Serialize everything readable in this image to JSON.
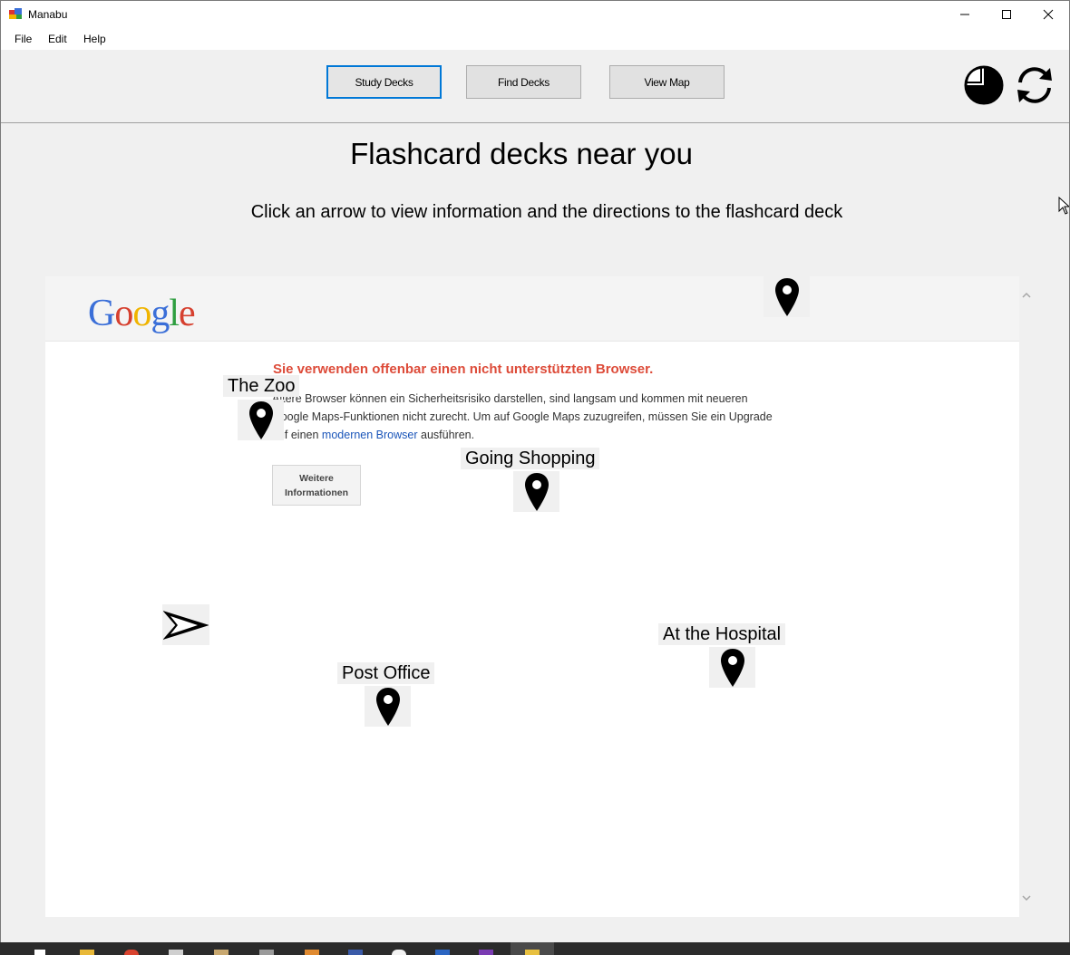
{
  "window": {
    "title": "Manabu",
    "controls": [
      "minimize",
      "maximize",
      "close"
    ]
  },
  "menu": {
    "items": [
      "File",
      "Edit",
      "Help"
    ]
  },
  "toolbar": {
    "buttons": [
      {
        "label": "Study Decks",
        "active": true
      },
      {
        "label": "Find Decks",
        "active": false
      },
      {
        "label": "View Map",
        "active": false
      }
    ],
    "icons": [
      "pie-chart-icon",
      "refresh-icon"
    ]
  },
  "page": {
    "heading": "Flashcard decks near you",
    "subheading": "Click an arrow to view information and the directions to the flashcard deck"
  },
  "map": {
    "logo": "Google",
    "warning_title": "Sie verwenden offenbar einen nicht unterstützten Browser.",
    "warning_line1": "Ältere Browser können ein Sicherheitsrisiko darstellen, sind langsam und kommen mit neueren",
    "warning_line2": "Google Maps-Funktionen nicht zurecht. Um auf Google Maps zuzugreifen, müssen Sie ein Upgrade",
    "warning_line3_pre": "auf einen ",
    "warning_link": "modernen Browser",
    "warning_line3_post": " ausführen.",
    "more_button_line1": "Weitere",
    "more_button_line2": "Informationen",
    "markers": [
      {
        "label": ""
      },
      {
        "label": "The Zoo"
      },
      {
        "label": "Going Shopping"
      },
      {
        "label": "At the Hospital"
      },
      {
        "label": "Post Office"
      }
    ]
  },
  "colors": {
    "accent": "#0078d7",
    "warning": "#dd4b39",
    "link": "#1a55b9"
  }
}
